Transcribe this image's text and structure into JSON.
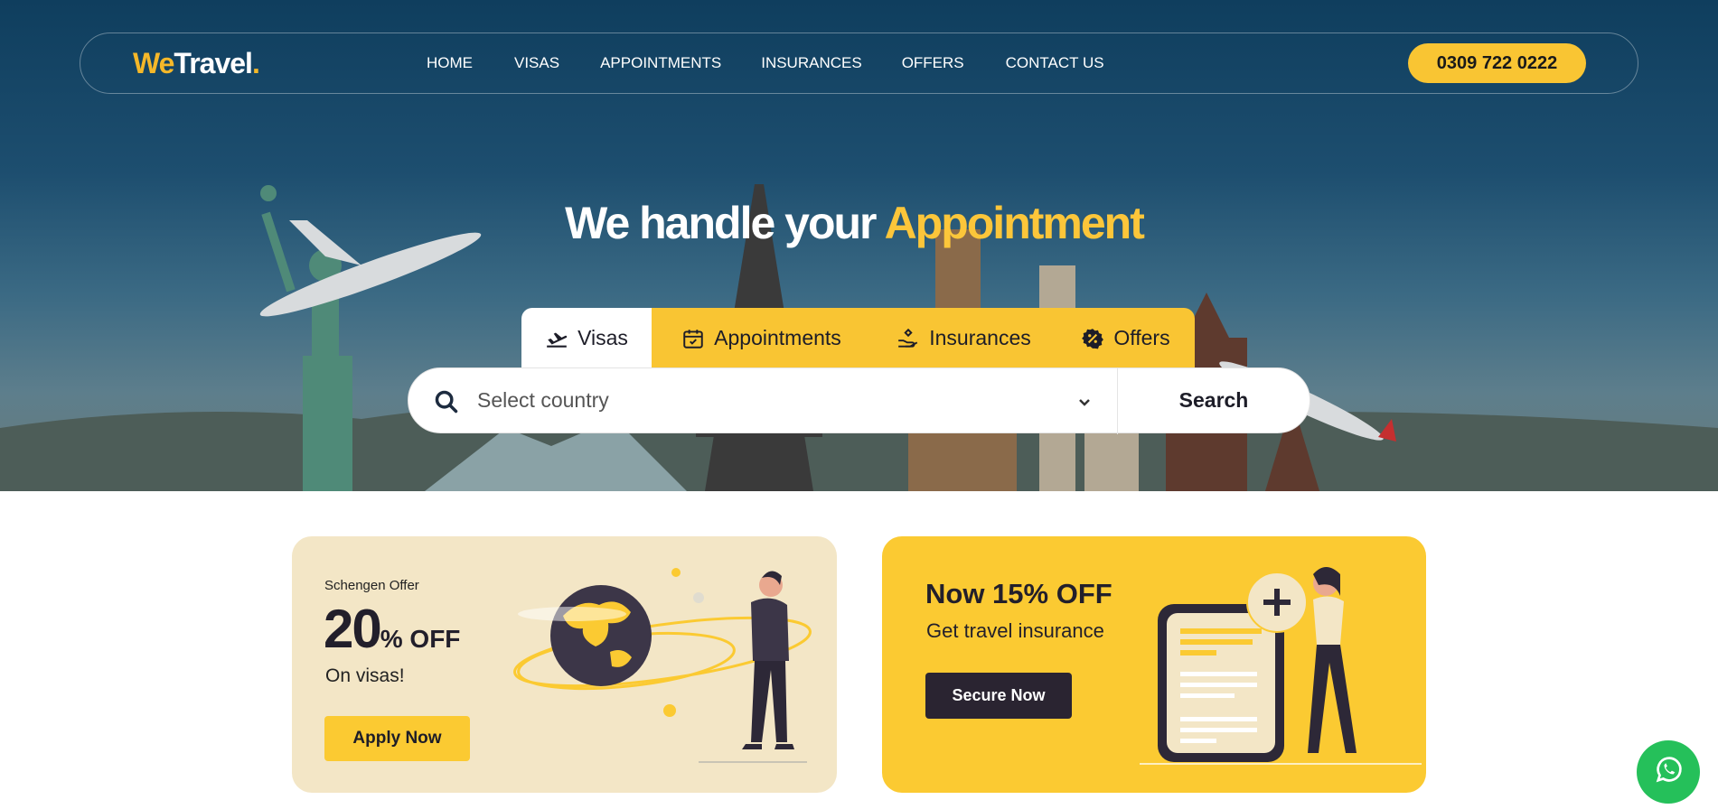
{
  "brand": {
    "we": "We",
    "travel": "Travel",
    "dot": ".",
    "accent": "#f5b829"
  },
  "nav": {
    "links": [
      "HOME",
      "VISAS",
      "APPOINTMENTS",
      "INSURANCES",
      "OFFERS",
      "CONTACT US"
    ],
    "phone": "0309 722 0222"
  },
  "hero": {
    "headline_prefix": "We handle your ",
    "headline_accent": "Appointment",
    "tabs": [
      {
        "label": "Visas",
        "icon": "plane-departure-icon"
      },
      {
        "label": "Appointments",
        "icon": "calendar-check-icon"
      },
      {
        "label": "Insurances",
        "icon": "hand-holding-icon"
      },
      {
        "label": "Offers",
        "icon": "badge-percent-icon"
      }
    ],
    "active_tab": "Visas"
  },
  "search": {
    "select_value": "Select country",
    "button_label": "Search",
    "icon": "search-icon",
    "dropdown_icon": "chevron-down-icon"
  },
  "offers": [
    {
      "eyebrow": "Schengen Offer",
      "amount": "20",
      "suffix": "% OFF",
      "subtitle": "On visas!",
      "cta": "Apply Now",
      "background": "#f3e6c6"
    },
    {
      "title": "Now 15% OFF",
      "subtitle": "Get travel insurance",
      "cta": "Secure Now",
      "background": "#fbca32"
    }
  ],
  "colors": {
    "yellow": "#f9c533",
    "dark": "#221f2b",
    "whatsapp": "#25c05a"
  },
  "floating": {
    "icon": "whatsapp-icon"
  }
}
